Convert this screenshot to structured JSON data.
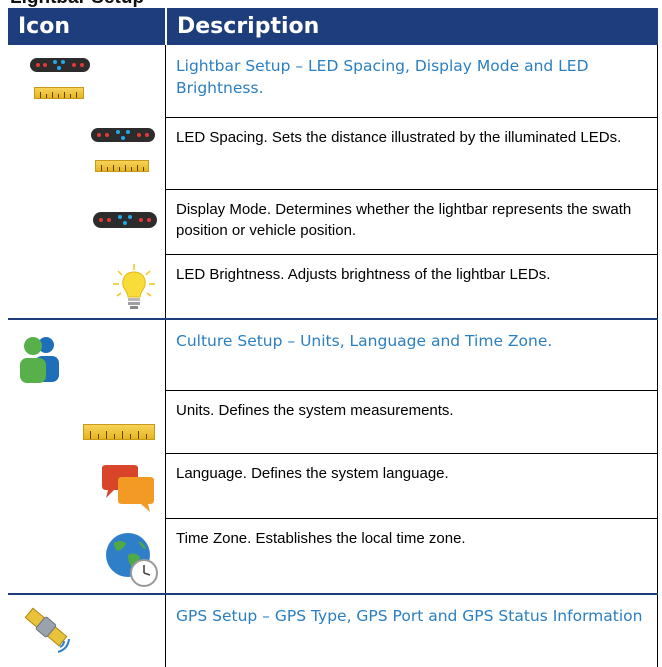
{
  "page_heading_clipped": "Lightbar Setup",
  "header": {
    "icon_label": "Icon",
    "description_label": "Description"
  },
  "rows": [
    {
      "kind": "section",
      "icon": "lightbar-with-ruler-icon",
      "text": "Lightbar Setup – LED Spacing, Display Mode and LED Brightness."
    },
    {
      "kind": "item",
      "icon": "lightbar-with-ruler-icon",
      "text": "LED Spacing. Sets the distance illustrated by the illuminated LEDs."
    },
    {
      "kind": "item",
      "icon": "lightbar-icon",
      "text": "Display Mode. Determines whether the lightbar represents the swath position or vehicle position."
    },
    {
      "kind": "item",
      "icon": "lightbulb-icon",
      "text": "LED Brightness. Adjusts brightness of the lightbar LEDs."
    },
    {
      "kind": "section",
      "icon": "users-icon",
      "text": "Culture Setup – Units, Language and Time Zone."
    },
    {
      "kind": "item",
      "icon": "ruler-icon",
      "text": "Units. Defines the system measurements."
    },
    {
      "kind": "item",
      "icon": "speech-bubbles-icon",
      "text": "Language. Defines the system language."
    },
    {
      "kind": "item",
      "icon": "globe-clock-icon",
      "text": "Time Zone. Establishes the local time zone."
    },
    {
      "kind": "section",
      "icon": "gps-satellite-icon",
      "text": "GPS Setup – GPS Type, GPS Port and GPS Status Information"
    }
  ],
  "colors": {
    "header_bg": "#1d3d7c",
    "section_text": "#2a7fc0",
    "led_red": "#e03a3a",
    "led_blue": "#23a8e8"
  }
}
